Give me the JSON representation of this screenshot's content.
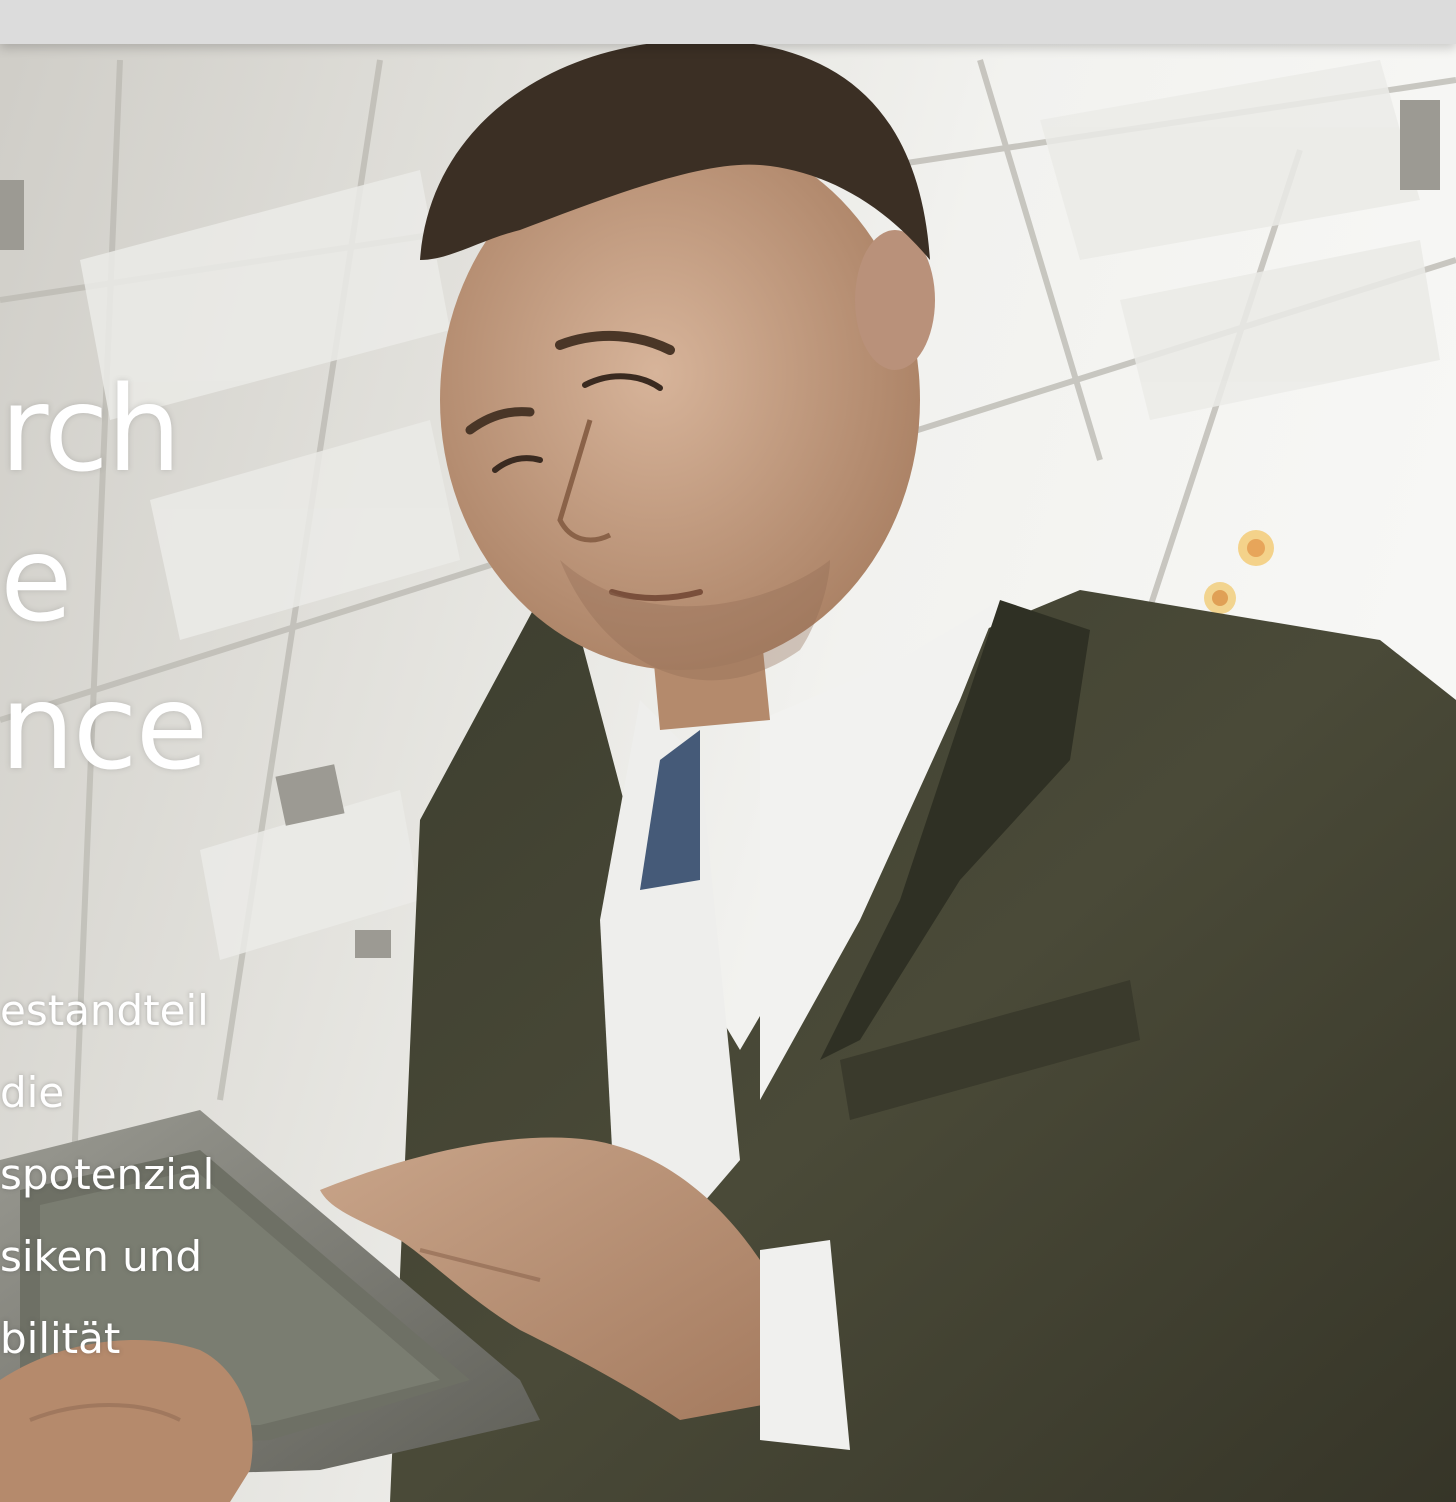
{
  "headline": {
    "line1": "rch",
    "line2": "e",
    "line3": "nce"
  },
  "body_text": {
    "line1": "estandteil",
    "line2": "die",
    "line3": "spotenzial",
    "line4": "siken und",
    "line5": "bilität"
  }
}
